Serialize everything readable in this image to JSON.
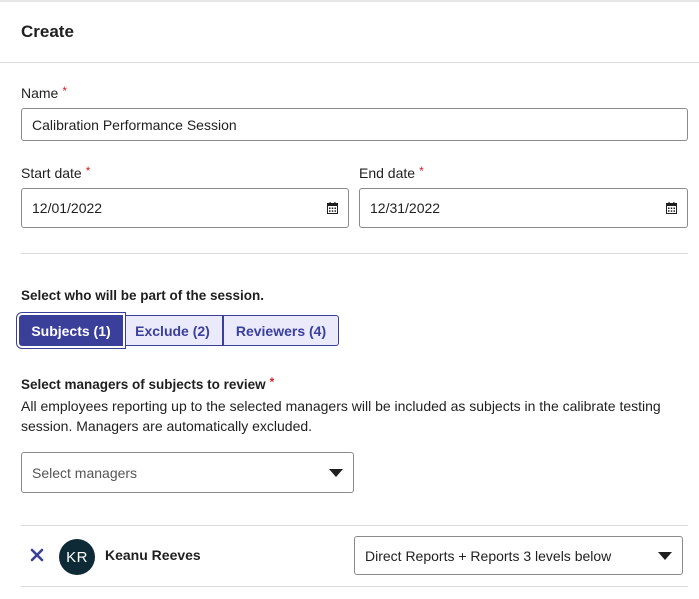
{
  "header": {
    "title": "Create"
  },
  "form": {
    "name_label": "Name",
    "name_value": "Calibration Performance Session",
    "start_label": "Start date",
    "start_value": "12/01/2022",
    "end_label": "End date",
    "end_value": "12/31/2022",
    "required_marker": "*",
    "session_prompt": "Select who will be part of the session.",
    "tabs": [
      {
        "label": "Subjects (1)",
        "active": true
      },
      {
        "label": "Exclude (2)",
        "active": false
      },
      {
        "label": "Reviewers (4)",
        "active": false
      }
    ],
    "managers_label": "Select managers of subjects to review",
    "managers_help": "All employees reporting up to the selected managers will be included as subjects in the calibrate testing session. Managers are automatically excluded.",
    "managers_placeholder": "Select managers"
  },
  "selected": [
    {
      "initials": "KR",
      "name": "Keanu Reeves",
      "scope": "Direct Reports + Reports 3 levels below",
      "remove_icon": "close-icon"
    }
  ],
  "colors": {
    "accent": "#3a3f9a",
    "required": "#d0202a",
    "avatar_bg": "#0e2a36"
  }
}
